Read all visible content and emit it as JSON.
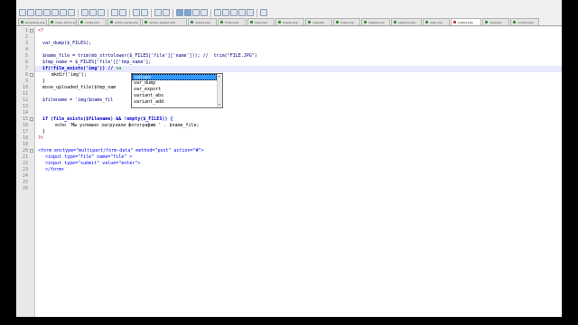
{
  "tabs": [
    {
      "label": "templates.php"
    },
    {
      "label": "index_admin.php"
    },
    {
      "label": "config.php"
    },
    {
      "label": "admin_panel.php"
    },
    {
      "label": "upload_subject.php"
    },
    {
      "label": "upload.php"
    },
    {
      "label": "footer.php"
    },
    {
      "label": "style.php"
    },
    {
      "label": "header.php"
    },
    {
      "label": "view.php"
    },
    {
      "label": "index.php"
    },
    {
      "label": "register.php"
    },
    {
      "label": "sessions.php"
    },
    {
      "label": "login.php"
    },
    {
      "label": "index2.php"
    },
    {
      "label": "view.php"
    },
    {
      "label": "contact.php"
    }
  ],
  "active_tab_index": 14,
  "lines": {
    "l1": "<?",
    "l3": "var_dump($_FILES);",
    "l5": "$name_file = trim(mb_strtolower($_FILES['file']['name'])); //  trim(\"FILE.JPG\")",
    "l6": "$tmp_name = $_FILES['file']['tmp_name'];",
    "l8_a": "if(!file_exists('img')) // ",
    "l8_b": "va",
    "l9": "mkdir('img');",
    "l10": "}",
    "l11_a": "move_uploaded_file($tmp_nam",
    "l13_a": "$filename = 'img/$name_fil",
    "l15": "if (file_exists($filename) && !empty($_FILES)) {",
    "l16": "echo 'Мы успешно загрузили фотографию ' . $name_file;",
    "l17": "}",
    "l18": "?>",
    "l20": "<form enctype=\"multipart/form-data\" method=\"post\" action=\"#\">",
    "l21": "<input type=\"file\" name=\"file\" >",
    "l22": "<input type=\"submit\" value=\"enter\">",
    "l23": "</form>"
  },
  "autocomplete": {
    "items": [
      "values",
      "var_dump",
      "var_export",
      "variant_abs",
      "variant_add"
    ],
    "selected_index": 0
  }
}
